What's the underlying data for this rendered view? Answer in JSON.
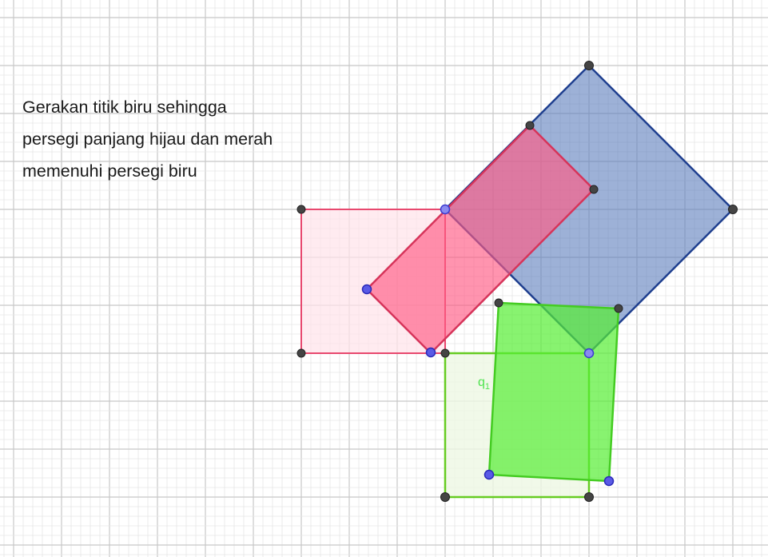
{
  "instruction": {
    "line1": "Gerakan titik biru sehingga",
    "line2": "persegi panjang hijau dan merah",
    "line3": "memenuhi persegi biru"
  },
  "label_q1": {
    "base": "q",
    "sub": "1"
  },
  "colors": {
    "grid_major": "#c8c8c8",
    "grid_minor": "#e6e6e6",
    "blue_square_fill": "#5b7dbd",
    "blue_square_stroke": "#1f3f8f",
    "red_rect_fill": "#ff6b8f",
    "red_rect_stroke": "#d6345a",
    "red_square_fill": "#ffe3ea",
    "green_rect_fill": "#66ee44",
    "green_rect_stroke": "#44cc22",
    "green_square_fill": "#edf7e4",
    "green_square_stroke": "#66cc22",
    "point_black": "#444444",
    "point_blue": "#5a5ae6"
  }
}
